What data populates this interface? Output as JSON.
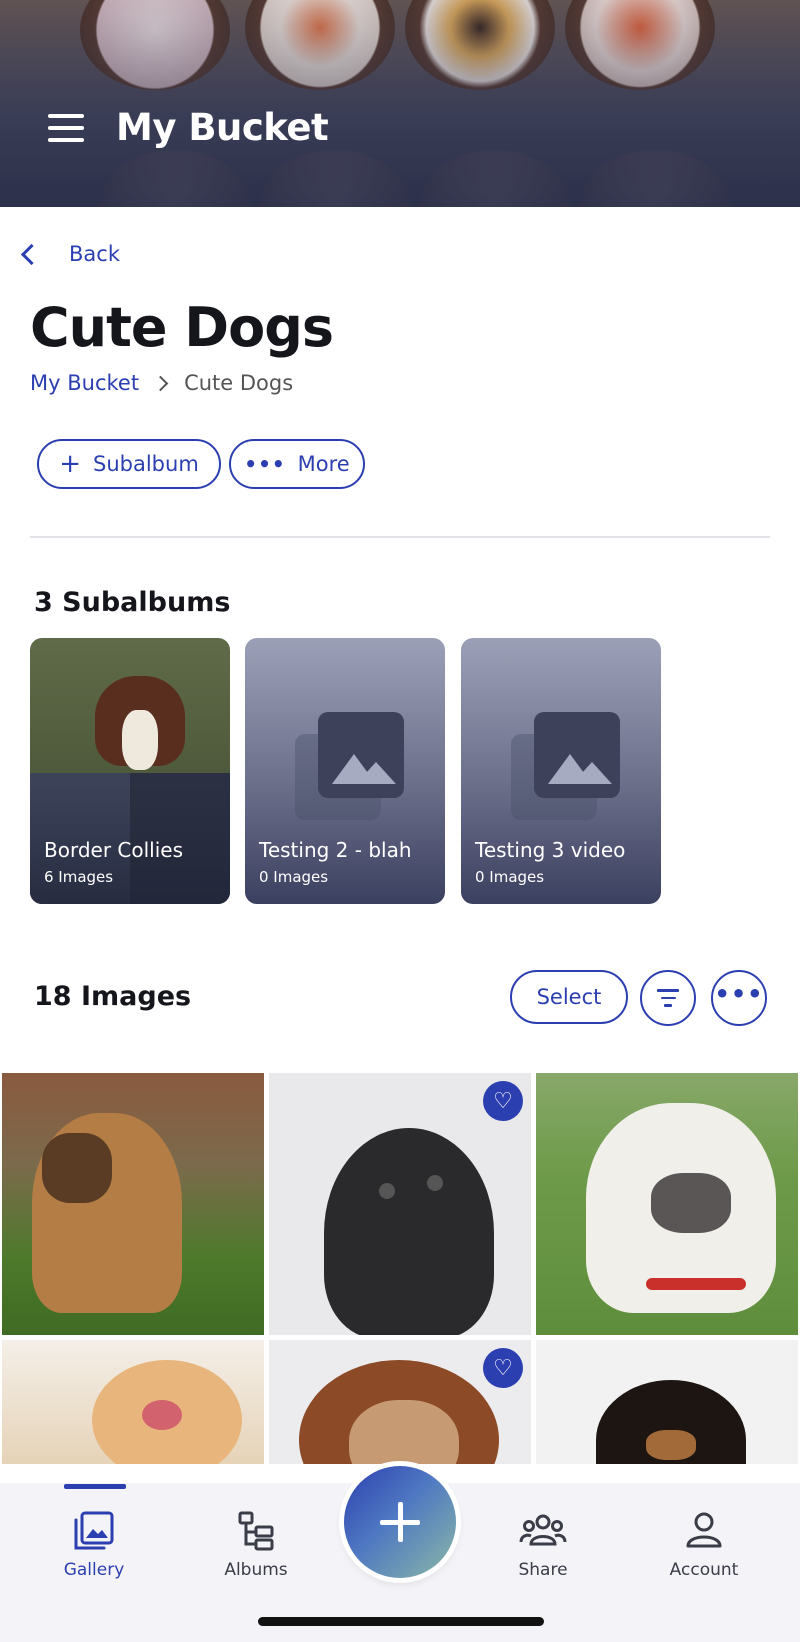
{
  "header": {
    "title": "My Bucket"
  },
  "nav": {
    "back_label": "Back"
  },
  "page": {
    "title": "Cute Dogs",
    "breadcrumb": {
      "root": "My Bucket",
      "current": "Cute Dogs"
    }
  },
  "actions": {
    "subalbum_label": "Subalbum",
    "more_label": "More"
  },
  "subalbums": {
    "heading": "3 Subalbums",
    "items": [
      {
        "name": "Border Collies",
        "count": "6 Images"
      },
      {
        "name": "Testing 2 - blah",
        "count": "0 Images"
      },
      {
        "name": "Testing 3 video",
        "count": "0 Images"
      }
    ]
  },
  "images": {
    "heading": "18 Images",
    "select_label": "Select"
  },
  "tabbar": {
    "items": [
      {
        "label": "Gallery"
      },
      {
        "label": "Albums"
      },
      {
        "label": "Share"
      },
      {
        "label": "Account"
      }
    ],
    "active": "Gallery"
  },
  "colors": {
    "accent": "#2c3fb0",
    "text": "#15161c",
    "tabbar_bg": "#f3f3f8"
  },
  "icons": [
    "menu-icon",
    "chevron-left-icon",
    "chevron-right-icon",
    "plus-icon",
    "more-icon",
    "filter-icon",
    "heart-icon",
    "gallery-icon",
    "albums-icon",
    "share-icon",
    "account-icon",
    "image-placeholder-icon"
  ]
}
